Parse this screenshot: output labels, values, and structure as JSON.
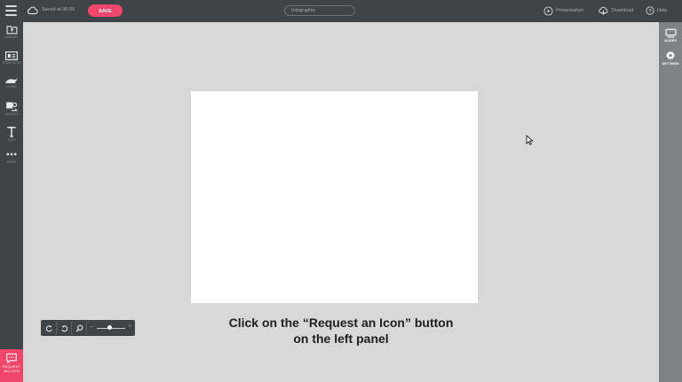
{
  "topbar": {
    "saved_text": "Saved at 00:00",
    "save_label": "SAVE",
    "title_value": "Infographic",
    "presentation_label": "Presentation",
    "download_label": "Download",
    "help_label": "Help"
  },
  "leftbar": {
    "items": [
      {
        "label": "LIBRARY",
        "icon": "folder-icon"
      },
      {
        "label": "TEMPLATES",
        "icon": "templates-icon"
      },
      {
        "label": "ICONS",
        "icon": "icons-icon"
      },
      {
        "label": "SHAPES",
        "icon": "shapes-icon"
      },
      {
        "label": "TEXT",
        "icon": "text-icon"
      },
      {
        "label": "MORE",
        "icon": "more-icon"
      }
    ],
    "request_line1": "REQUEST",
    "request_line2": "AN ICON"
  },
  "rightbar": {
    "items": [
      {
        "label": "SLIDES",
        "icon": "slides-icon"
      },
      {
        "label": "SETTINGS",
        "icon": "gear-icon"
      }
    ]
  },
  "zoom": {
    "minus": "–",
    "plus": "+",
    "level": 0.45
  },
  "caption": {
    "line1": "Click on the “Request an Icon” button",
    "line2": "on the left panel"
  },
  "colors": {
    "accent": "#f0466b",
    "bar": "#3f4449",
    "workspace": "#d8d8d8",
    "rightbar": "#7c8388"
  }
}
